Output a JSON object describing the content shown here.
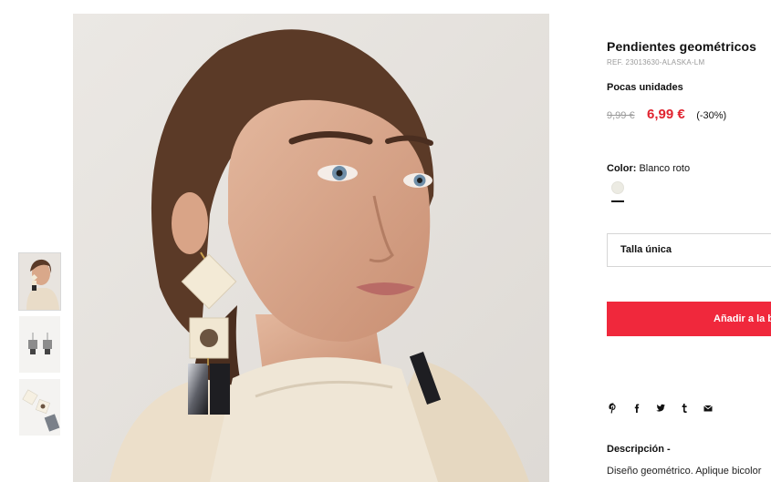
{
  "product": {
    "title": "Pendientes geométricos",
    "reference": "REF. 23013630-ALASKA-LM",
    "stock_status": "Pocas unidades",
    "old_price": "9,99 €",
    "new_price": "6,99 €",
    "discount": "(-30%)",
    "color_label": "Color:",
    "color_value": "Blanco roto",
    "swatch_color": "#ecebe3",
    "size_select": "Talla única",
    "add_to_cart": "Añadir a la bolsa",
    "description_heading": "Descripción -",
    "description_text": "Diseño geométrico. Aplique bicolor"
  },
  "gallery": {
    "thumbnails": [
      {
        "name": "model-wearing-earring",
        "active": true
      },
      {
        "name": "earrings-pair-flat",
        "active": false
      },
      {
        "name": "earrings-detail",
        "active": false
      }
    ]
  },
  "share": {
    "icons": [
      "pinterest-icon",
      "facebook-icon",
      "twitter-icon",
      "tumblr-icon",
      "email-icon"
    ]
  },
  "colors": {
    "accent": "#f0283c",
    "sale_price": "#e0232f",
    "muted": "#9a9a9a"
  }
}
